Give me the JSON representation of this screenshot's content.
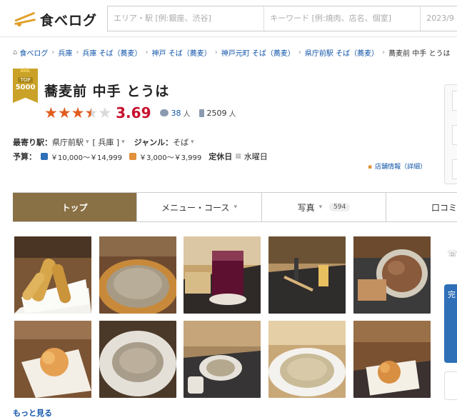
{
  "header": {
    "logo_text": "食べログ",
    "area_placeholder": "エリア・駅 [例:銀座、渋谷]",
    "keyword_placeholder": "キーワード [例:焼肉、店名、個室]",
    "date_partial": "2023/9"
  },
  "breadcrumb": [
    {
      "label": "食べログ"
    },
    {
      "label": "兵庫"
    },
    {
      "label": "兵庫 そば（蕎麦）"
    },
    {
      "label": "神戸 そば（蕎麦）"
    },
    {
      "label": "神戸元町 そば（蕎麦）"
    },
    {
      "label": "県庁前駅 そば（蕎麦）"
    }
  ],
  "breadcrumb_current": "蕎麦前 中手 とうは",
  "badge": {
    "top": "TOP",
    "number": "5000"
  },
  "shop": {
    "name": "蕎麦前 中手 とうは",
    "score": "3.69",
    "rating_fraction": 0.69,
    "reviews": "38",
    "reviews_unit": "人",
    "saves": "2509",
    "saves_unit": "人"
  },
  "info": {
    "station_label": "最寄り駅：",
    "station": "県庁前駅",
    "pref": "[ 兵庫 ]",
    "genre_label": "ジャンル：",
    "genre": "そば",
    "budget_label": "予算：",
    "dinner_price": "￥10,000～￥14,999",
    "lunch_price": "￥3,000～￥3,999",
    "closed_label": "定休日",
    "closed": "水曜日",
    "detail_link": "店舗情報（詳細）"
  },
  "tabs": [
    {
      "label": "トップ",
      "active": true
    },
    {
      "label": "メニュー・コース"
    },
    {
      "label": "写真",
      "count": "594"
    },
    {
      "label": "口コミ"
    }
  ],
  "gallery": {
    "more": "もっと見る"
  },
  "side": {
    "blue_text": "完"
  },
  "colors": {
    "accent": "#8a7045",
    "score": "#c8102e",
    "star": "#e05c1e",
    "link": "#1155aa"
  }
}
